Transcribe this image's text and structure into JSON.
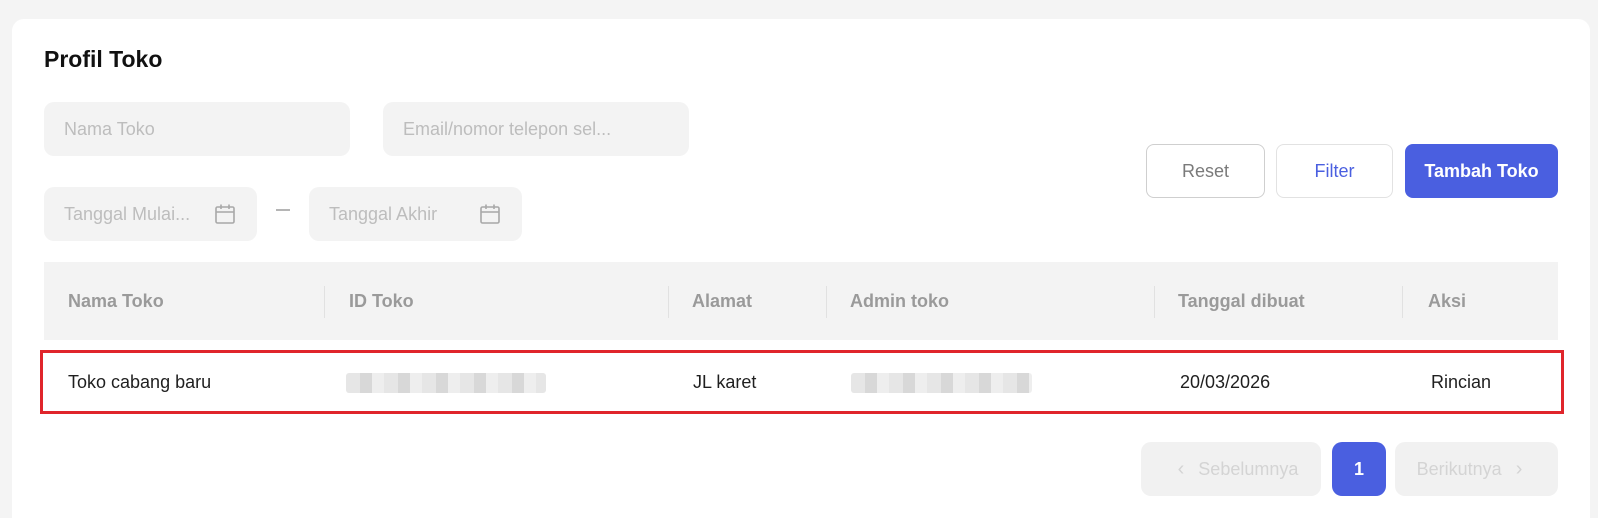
{
  "page": {
    "title": "Profil Toko"
  },
  "filters": {
    "store_name_placeholder": "Nama Toko",
    "email_phone_placeholder": "Email/nomor telepon sel...",
    "start_date_placeholder": "Tanggal Mulai...",
    "end_date_placeholder": "Tanggal Akhir"
  },
  "actions": {
    "reset_label": "Reset",
    "filter_label": "Filter",
    "add_label": "Tambah Toko"
  },
  "table": {
    "columns": [
      "Nama Toko",
      "ID Toko",
      "Alamat",
      "Admin toko",
      "Tanggal dibuat",
      "Aksi"
    ],
    "rows": [
      {
        "name": "Toko cabang baru",
        "address": "JL karet",
        "created": "20/03/2026",
        "action": "Rincian"
      }
    ]
  },
  "pagination": {
    "prev_label": "Sebelumnya",
    "page": "1",
    "next_label": "Berikutnya"
  },
  "colors": {
    "accent": "#4a5fe0",
    "highlight_border": "#e0252b"
  },
  "icons": {
    "date": "calendar-icon",
    "prev": "chevron-left-icon",
    "next": "chevron-right-icon"
  }
}
